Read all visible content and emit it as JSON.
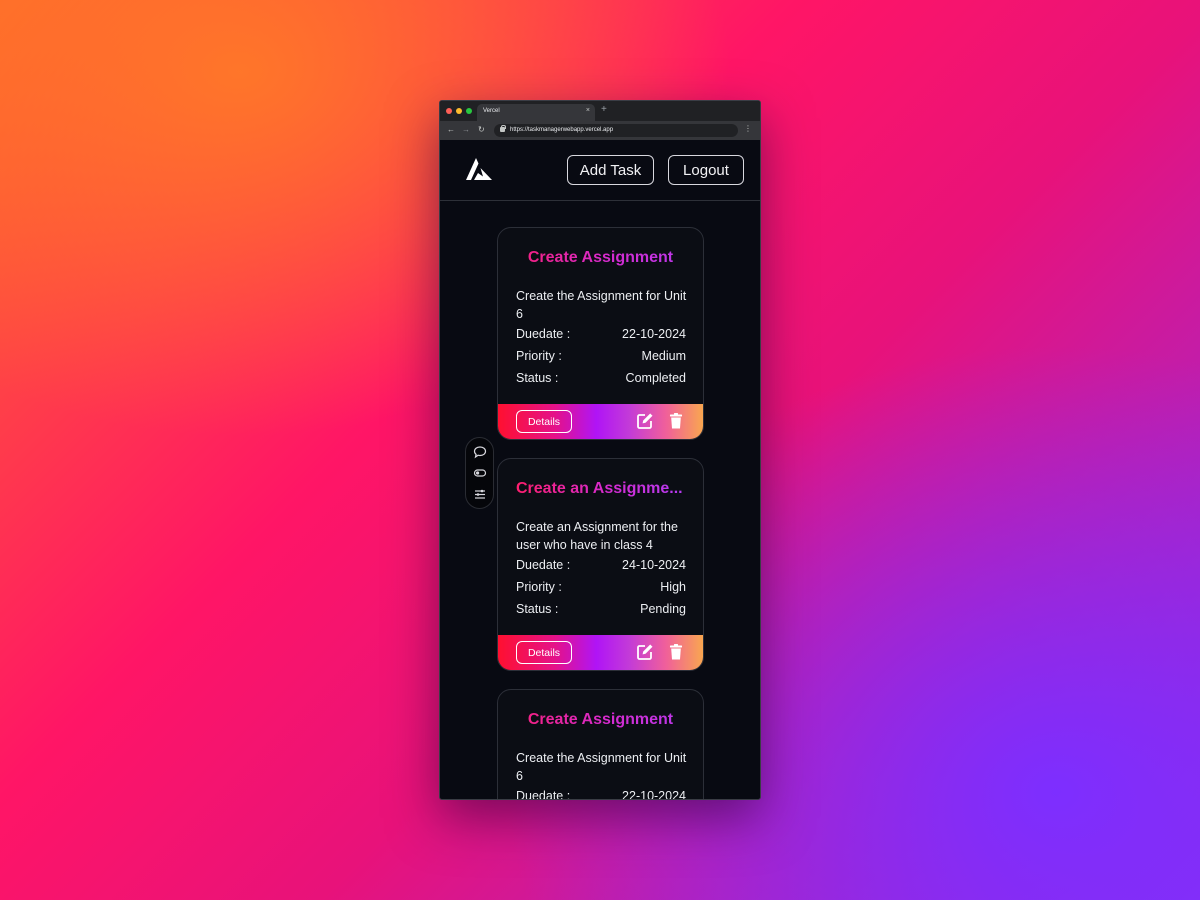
{
  "browser": {
    "tab_title": "Vercel",
    "tab_close": "×",
    "new_tab": "+",
    "url": "https://taskmanagerwebapp.vercel.app",
    "traffic_light_colors": [
      "#ff5f57",
      "#febc2e",
      "#28c840"
    ]
  },
  "header": {
    "logo_icon": "triangle-a-logo-icon",
    "add_task_label": "Add Task",
    "logout_label": "Logout"
  },
  "cards": [
    {
      "title": "Create Assignment",
      "description": "Create the Assignment for Unit 6",
      "duedate_label": "Duedate :",
      "duedate": "22-10-2024",
      "priority_label": "Priority :",
      "priority": "Medium",
      "status_label": "Status :",
      "status": "Completed",
      "details_label": "Details"
    },
    {
      "title": "Create an Assignme...",
      "description": "Create an Assignment for the user who have in class 4",
      "duedate_label": "Duedate :",
      "duedate": "24-10-2024",
      "priority_label": "Priority :",
      "priority": "High",
      "status_label": "Status :",
      "status": "Pending",
      "details_label": "Details"
    },
    {
      "title": "Create Assignment",
      "description": "Create the Assignment for Unit 6",
      "duedate_label": "Duedate :",
      "duedate": "22-10-2024"
    }
  ],
  "side_widget": {
    "icons": [
      "chat-bubble-icon",
      "toggle-icon",
      "sliders-icon"
    ]
  },
  "theme": {
    "accent_gradient": [
      "#ff1030",
      "#b014f6",
      "#f9a650"
    ],
    "card_background": "#0b0d14",
    "page_background": "#080a12"
  }
}
